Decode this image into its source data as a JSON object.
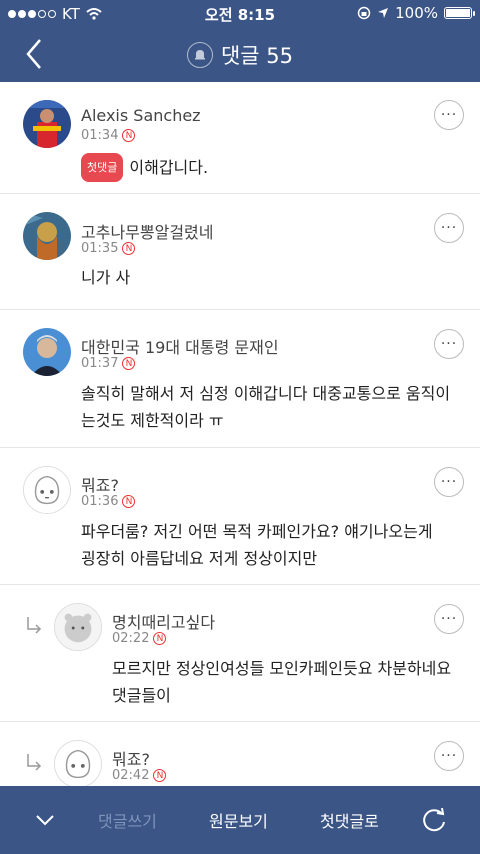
{
  "status_bar": {
    "carrier": "KT",
    "time": "오전 8:15",
    "battery": "100%",
    "battery_level": 1.0
  },
  "header": {
    "title": "댓글 55"
  },
  "comments": [
    {
      "name": "Alexis Sanchez",
      "time": "01:34",
      "badge": "첫댓글",
      "text": "이해갑니다.",
      "reply": false
    },
    {
      "name": "고추나무뽕알걸렸네",
      "time": "01:35",
      "text": "니가 사",
      "reply": false
    },
    {
      "name": "대한민국 19대 대통령 문재인",
      "time": "01:37",
      "text": "솔직히 말해서 저 심정 이해갑니다 대중교통으로 움직이는것도 제한적이라 ㅠ",
      "reply": false
    },
    {
      "name": "뭐죠?",
      "time": "01:36",
      "text": "파우더룸? 저긴 어떤 목적 카페인가요? 얘기나오는게 굉장히 아름답네요 저게 정상이지만",
      "reply": false
    },
    {
      "name": "명치때리고싶다",
      "time": "02:22",
      "text": "모르지만 정상인여성들 모인카페인듯요 차분하네요 댓글들이",
      "reply": true
    },
    {
      "name": "뭐죠?",
      "time": "02:42",
      "text": "",
      "reply": true
    }
  ],
  "new_marker": "N",
  "more_label": "···",
  "bottom_bar": {
    "write": "댓글쓰기",
    "original": "원문보기",
    "first": "첫댓글로"
  },
  "icons": [
    "back-icon",
    "bell-icon",
    "more-icon",
    "reply-arrow-icon",
    "chevron-down-icon",
    "refresh-icon"
  ],
  "colors": {
    "nav": "#3a5586",
    "badge": "#e8484f"
  }
}
